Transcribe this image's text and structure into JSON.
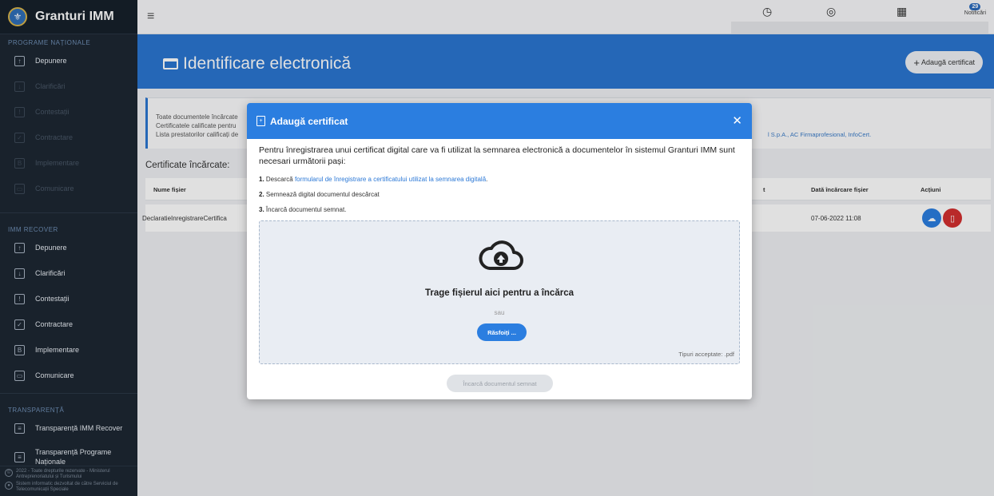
{
  "app": {
    "name": "Granturi IMM"
  },
  "sidebar": {
    "sections": [
      {
        "title": "PROGRAME NAȚIONALE",
        "items": [
          {
            "label": "Depunere",
            "icon": "upload-icon",
            "dim": false
          },
          {
            "label": "Clarificări",
            "icon": "clarify-icon",
            "dim": true
          },
          {
            "label": "Contestații",
            "icon": "contest-icon",
            "dim": true
          },
          {
            "label": "Contractare",
            "icon": "contract-icon",
            "dim": true
          },
          {
            "label": "Implementare",
            "icon": "implement-icon",
            "dim": true
          },
          {
            "label": "Comunicare",
            "icon": "chat-icon",
            "dim": true
          }
        ]
      },
      {
        "title": "IMM RECOVER",
        "items": [
          {
            "label": "Depunere",
            "icon": "upload-icon",
            "dim": false
          },
          {
            "label": "Clarificări",
            "icon": "clarify-icon",
            "dim": false
          },
          {
            "label": "Contestații",
            "icon": "contest-icon",
            "dim": false
          },
          {
            "label": "Contractare",
            "icon": "contract-icon",
            "dim": false
          },
          {
            "label": "Implementare",
            "icon": "implement-icon",
            "dim": false
          },
          {
            "label": "Comunicare",
            "icon": "chat-icon",
            "dim": false
          }
        ]
      },
      {
        "title": "TRANSPARENȚĂ",
        "items": [
          {
            "label": "Transparență IMM Recover",
            "icon": "list-icon",
            "dim": false
          },
          {
            "label": "Transparență Programe Naționale",
            "icon": "list-icon",
            "dim": false
          }
        ]
      }
    ],
    "footer": {
      "copyright": "2022 - Toate drepturile rezervate - Ministerul Antreprenoriatului și Turismului",
      "system": "Sistem informatic dezvoltat de către Serviciul de Telecomunicații Speciale"
    }
  },
  "topbar": {
    "notifications_label": "Notificări",
    "notifications_count": "29"
  },
  "page": {
    "title": "Identificare electronică",
    "add_certificate_label": "Adaugă certificat"
  },
  "info": {
    "line1": "Toate documentele încărcate",
    "line2": "Certificatele calificate pentru",
    "line3": "Lista prestatorilor calificați de",
    "tail": "l S.p.A., AC Firmaprofesional, InfoCert."
  },
  "certificates": {
    "title": "Certificate încărcate:",
    "columns": {
      "file_name": "Nume fișier",
      "upload_date": "Dată încărcare fișier",
      "actions": "Acțiuni"
    },
    "col_fragment": "t",
    "rows": [
      {
        "file_name": "DeclaratieInregistrareCertifica",
        "upload_date": "07-06-2022 11:08"
      }
    ]
  },
  "modal": {
    "title": "Adaugă certificat",
    "intro": "Pentru înregistrarea unui certificat digital care va fi utilizat la semnarea electronică a documentelor în sistemul Granturi IMM sunt necesari următorii pași:",
    "step1_num": "1.",
    "step1_prefix": "Descarcă",
    "step1_link": "formularul de înregistrare a certificatului utilizat la semnarea digitală",
    "step1_suffix": ".",
    "step2_num": "2.",
    "step2_text": "Semnează digital documentul descărcat",
    "step3_num": "3.",
    "step3_text": "Încarcă documentul semnat.",
    "dropzone": {
      "drag_text": "Trage fișierul aici pentru a încărca",
      "or_text": "sau",
      "browse_label": "Răsfoiți ...",
      "accepted_types": "Tipuri acceptate: .pdf"
    },
    "upload_signed_label": "Încarcă documentul semnat"
  },
  "colors": {
    "primary": "#2b7ee0",
    "sidebar": "#1d2733",
    "danger": "#d32f2f"
  }
}
